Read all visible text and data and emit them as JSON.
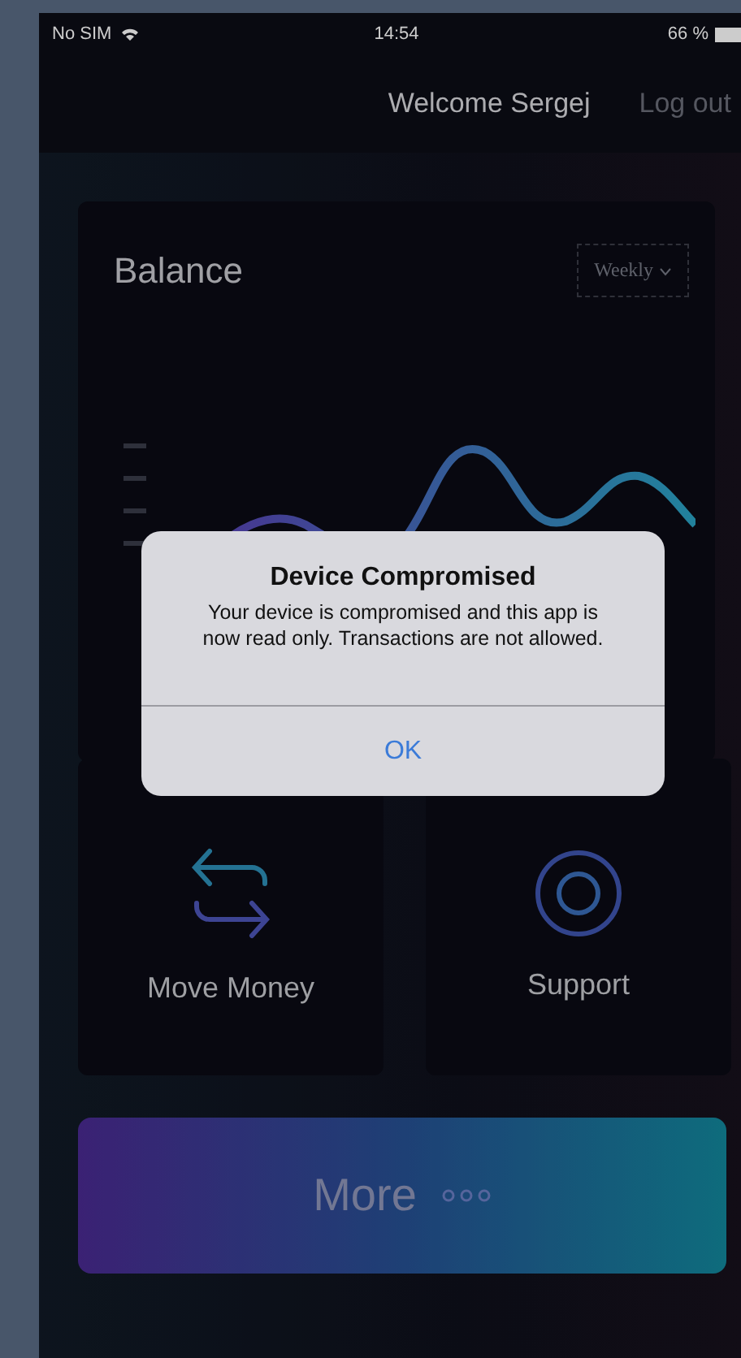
{
  "status_bar": {
    "carrier": "No SIM",
    "time": "14:54",
    "battery": "66 %"
  },
  "header": {
    "title": "Welcome Sergej",
    "action": "Log out"
  },
  "balance_card": {
    "title": "Balance",
    "period": "Weekly"
  },
  "tiles": [
    {
      "label": "Move Money",
      "kind": "transfer"
    },
    {
      "label": "Support",
      "kind": "support"
    }
  ],
  "more_button": {
    "label": "More"
  },
  "alert": {
    "title": "Device Compromised",
    "message": "Your device is compromised and this app is now read only. Transactions are not allowed.",
    "button": "OK"
  }
}
